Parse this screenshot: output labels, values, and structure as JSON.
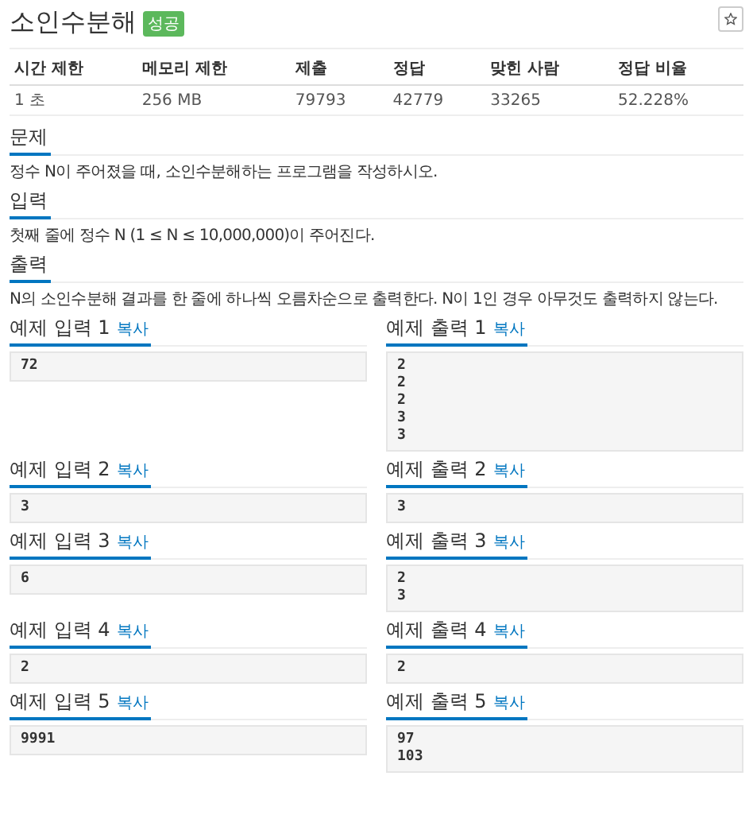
{
  "problem": {
    "title": "소인수분해",
    "badge": "성공"
  },
  "info_table": {
    "columns": [
      "시간 제한",
      "메모리 제한",
      "제출",
      "정답",
      "맞힌 사람",
      "정답 비율"
    ],
    "row": [
      "1 초",
      "256 MB",
      "79793",
      "42779",
      "33265",
      "52.228%"
    ]
  },
  "sections": [
    {
      "heading": "문제",
      "text": "정수 N이 주어졌을 때, 소인수분해하는 프로그램을 작성하시오."
    },
    {
      "heading": "입력",
      "text": "첫째 줄에 정수 N (1 ≤ N ≤ 10,000,000)이 주어진다."
    },
    {
      "heading": "출력",
      "text": "N의 소인수분해 결과를 한 줄에 하나씩 오름차순으로 출력한다. N이 1인 경우 아무것도 출력하지 않는다."
    }
  ],
  "examples": [
    {
      "input": {
        "label": "예제 입력 1",
        "copy": "복사",
        "data": "72"
      },
      "output": {
        "label": "예제 출력 1",
        "copy": "복사",
        "data": "2\n2\n2\n3\n3"
      }
    },
    {
      "input": {
        "label": "예제 입력 2",
        "copy": "복사",
        "data": "3"
      },
      "output": {
        "label": "예제 출력 2",
        "copy": "복사",
        "data": "3"
      }
    },
    {
      "input": {
        "label": "예제 입력 3",
        "copy": "복사",
        "data": "6"
      },
      "output": {
        "label": "예제 출력 3",
        "copy": "복사",
        "data": "2\n3"
      }
    },
    {
      "input": {
        "label": "예제 입력 4",
        "copy": "복사",
        "data": "2"
      },
      "output": {
        "label": "예제 출력 4",
        "copy": "복사",
        "data": "2"
      }
    },
    {
      "input": {
        "label": "예제 입력 5",
        "copy": "복사",
        "data": "9991"
      },
      "output": {
        "label": "예제 출력 5",
        "copy": "복사",
        "data": "97\n103"
      }
    }
  ]
}
